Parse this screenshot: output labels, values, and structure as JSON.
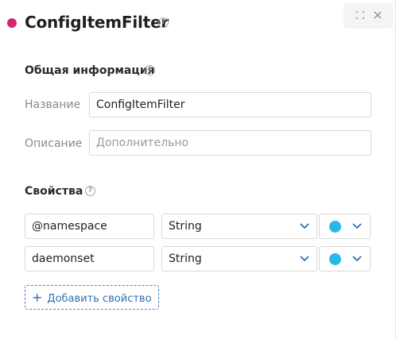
{
  "header": {
    "title": "ConfigItemFilter",
    "status_color": "#d6266f",
    "help_icon": "question-circle-icon",
    "expand_icon": "expand-icon",
    "close_icon": "close-icon"
  },
  "general": {
    "title": "Общая информация",
    "name_label": "Название",
    "name_value": "ConfigItemFilter",
    "description_label": "Описание",
    "description_placeholder": "Дополнительно"
  },
  "properties": {
    "title": "Свойства",
    "rows": [
      {
        "name": "@namespace",
        "type": "String",
        "color": "#2ab7e8"
      },
      {
        "name": "daemonset",
        "type": "String",
        "color": "#2ab7e8"
      }
    ],
    "add_label": "Добавить свойство",
    "add_icon": "plus-icon"
  },
  "colors": {
    "accent": "#2f6fb3",
    "status": "#d6266f",
    "property_color": "#2ab7e8"
  }
}
